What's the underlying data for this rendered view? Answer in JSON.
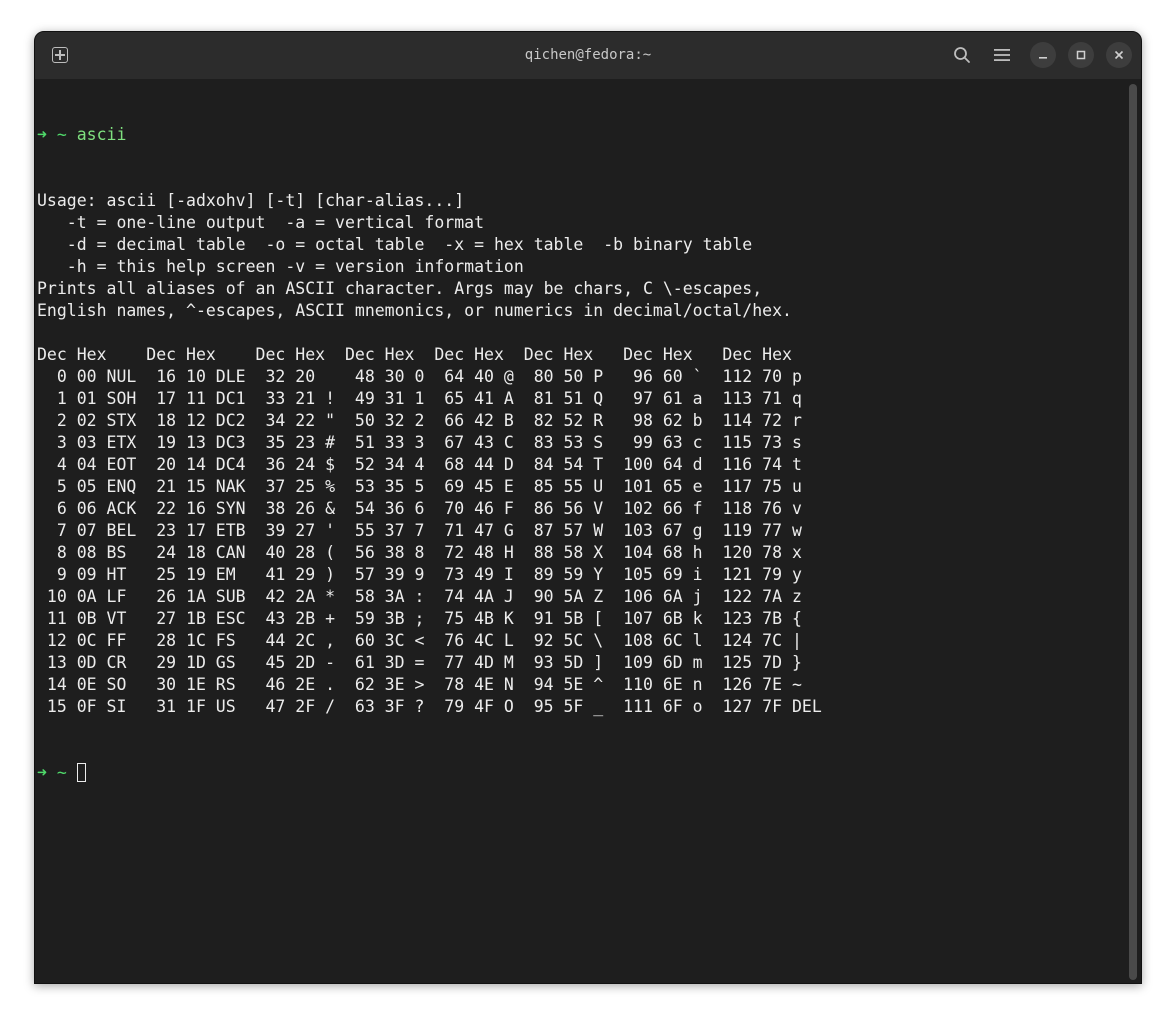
{
  "window": {
    "title": "qichen@fedora:~"
  },
  "icons": {
    "new_tab": "new-tab-icon",
    "search": "search-icon",
    "menu": "hamburger-menu-icon",
    "minimize": "minimize-icon",
    "maximize": "maximize-icon",
    "close": "close-icon"
  },
  "colors": {
    "background": "#1e1e1e",
    "titlebar": "#2c2c2c",
    "prompt": "#4fd96a",
    "text": "#ececec"
  },
  "terminal": {
    "prompt_arrow": "➜",
    "prompt_dir": "~",
    "command": "ascii",
    "output": [
      "Usage: ascii [-adxohv] [-t] [char-alias...]",
      "   -t = one-line output  -a = vertical format",
      "   -d = decimal table  -o = octal table  -x = hex table  -b binary table",
      "   -h = this help screen -v = version information",
      "Prints all aliases of an ASCII character. Args may be chars, C \\-escapes,",
      "English names, ^-escapes, ASCII mnemonics, or numerics in decimal/octal/hex.",
      "",
      "Dec Hex    Dec Hex    Dec Hex  Dec Hex  Dec Hex  Dec Hex   Dec Hex   Dec Hex",
      "  0 00 NUL  16 10 DLE  32 20    48 30 0  64 40 @  80 50 P   96 60 `  112 70 p",
      "  1 01 SOH  17 11 DC1  33 21 !  49 31 1  65 41 A  81 51 Q   97 61 a  113 71 q",
      "  2 02 STX  18 12 DC2  34 22 \"  50 32 2  66 42 B  82 52 R   98 62 b  114 72 r",
      "  3 03 ETX  19 13 DC3  35 23 #  51 33 3  67 43 C  83 53 S   99 63 c  115 73 s",
      "  4 04 EOT  20 14 DC4  36 24 $  52 34 4  68 44 D  84 54 T  100 64 d  116 74 t",
      "  5 05 ENQ  21 15 NAK  37 25 %  53 35 5  69 45 E  85 55 U  101 65 e  117 75 u",
      "  6 06 ACK  22 16 SYN  38 26 &  54 36 6  70 46 F  86 56 V  102 66 f  118 76 v",
      "  7 07 BEL  23 17 ETB  39 27 '  55 37 7  71 47 G  87 57 W  103 67 g  119 77 w",
      "  8 08 BS   24 18 CAN  40 28 (  56 38 8  72 48 H  88 58 X  104 68 h  120 78 x",
      "  9 09 HT   25 19 EM   41 29 )  57 39 9  73 49 I  89 59 Y  105 69 i  121 79 y",
      " 10 0A LF   26 1A SUB  42 2A *  58 3A :  74 4A J  90 5A Z  106 6A j  122 7A z",
      " 11 0B VT   27 1B ESC  43 2B +  59 3B ;  75 4B K  91 5B [  107 6B k  123 7B {",
      " 12 0C FF   28 1C FS   44 2C ,  60 3C <  76 4C L  92 5C \\  108 6C l  124 7C |",
      " 13 0D CR   29 1D GS   45 2D -  61 3D =  77 4D M  93 5D ]  109 6D m  125 7D }",
      " 14 0E SO   30 1E RS   46 2E .  62 3E >  78 4E N  94 5E ^  110 6E n  126 7E ~",
      " 15 0F SI   31 1F US   47 2F /  63 3F ?  79 4F O  95 5F _  111 6F o  127 7F DEL"
    ]
  }
}
